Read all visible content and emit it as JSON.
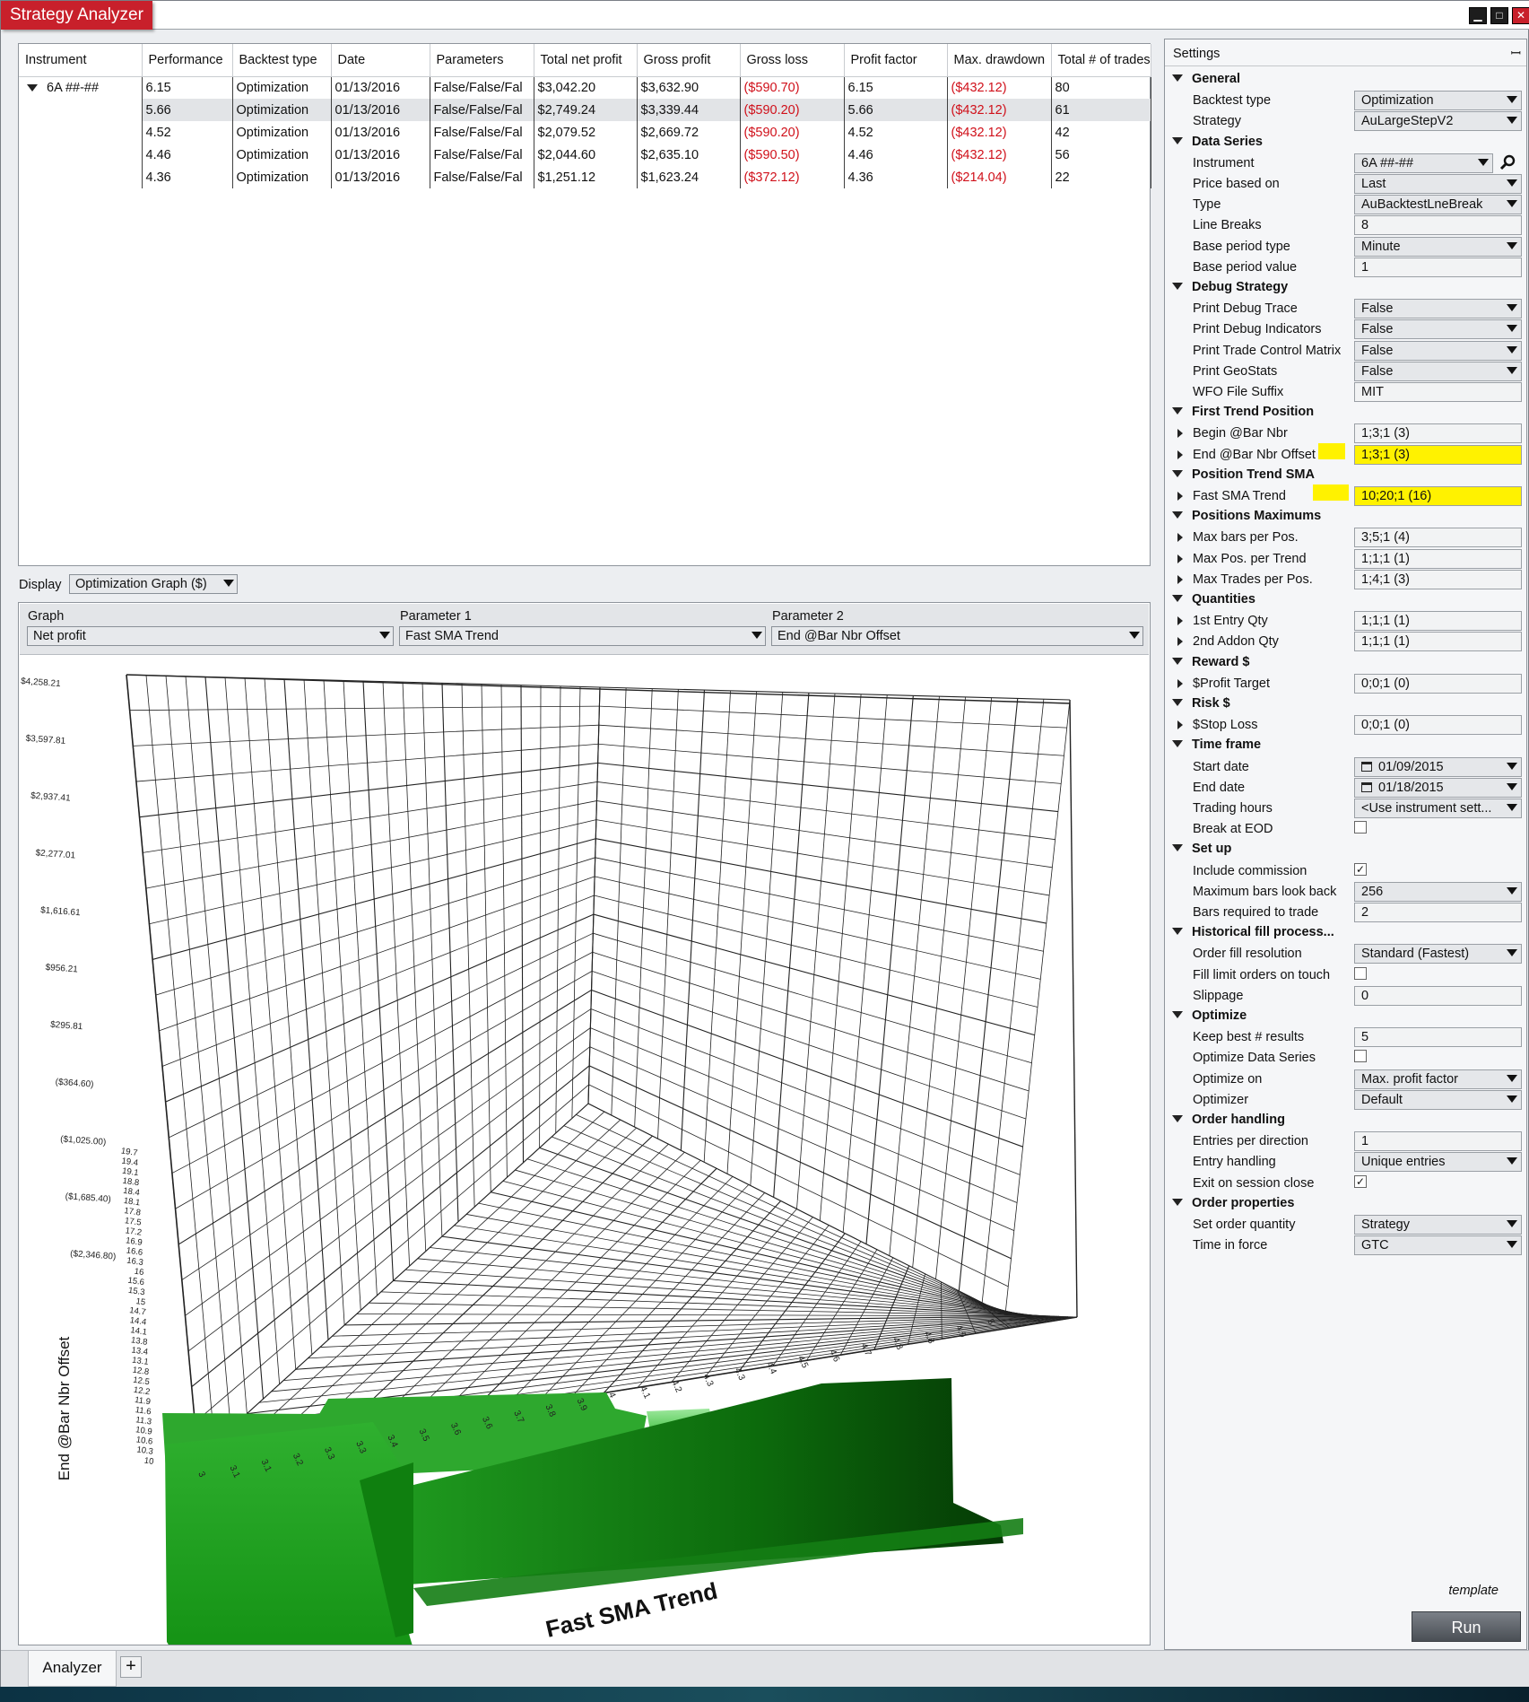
{
  "window": {
    "title": "Strategy Analyzer",
    "min_glyph": "▁",
    "max_glyph": "□",
    "close_glyph": "✕"
  },
  "grid": {
    "columns": [
      "Instrument",
      "Performance",
      "Backtest type",
      "Date",
      "Parameters",
      "Total net profit",
      "Gross profit",
      "Gross loss",
      "Profit factor",
      "Max. drawdown",
      "Total # of trades"
    ],
    "rows": [
      {
        "instrument": "6A ##-##",
        "performance": "6.15",
        "backtest": "Optimization",
        "date": "01/13/2016",
        "parameters": "False/False/Fal",
        "net": "$3,042.20",
        "gross_profit": "$3,632.90",
        "gross_loss": "($590.70)",
        "pf": "6.15",
        "dd": "($432.12)",
        "trades": "80"
      },
      {
        "instrument": "",
        "performance": "5.66",
        "backtest": "Optimization",
        "date": "01/13/2016",
        "parameters": "False/False/Fal",
        "net": "$2,749.24",
        "gross_profit": "$3,339.44",
        "gross_loss": "($590.20)",
        "pf": "5.66",
        "dd": "($432.12)",
        "trades": "61"
      },
      {
        "instrument": "",
        "performance": "4.52",
        "backtest": "Optimization",
        "date": "01/13/2016",
        "parameters": "False/False/Fal",
        "net": "$2,079.52",
        "gross_profit": "$2,669.72",
        "gross_loss": "($590.20)",
        "pf": "4.52",
        "dd": "($432.12)",
        "trades": "42"
      },
      {
        "instrument": "",
        "performance": "4.46",
        "backtest": "Optimization",
        "date": "01/13/2016",
        "parameters": "False/False/Fal",
        "net": "$2,044.60",
        "gross_profit": "$2,635.10",
        "gross_loss": "($590.50)",
        "pf": "4.46",
        "dd": "($432.12)",
        "trades": "56"
      },
      {
        "instrument": "",
        "performance": "4.36",
        "backtest": "Optimization",
        "date": "01/13/2016",
        "parameters": "False/False/Fal",
        "net": "$1,251.12",
        "gross_profit": "$1,623.24",
        "gross_loss": "($372.12)",
        "pf": "4.36",
        "dd": "($214.04)",
        "trades": "22"
      }
    ]
  },
  "display": {
    "label": "Display",
    "value": "Optimization Graph ($)"
  },
  "graph_header": {
    "graph_label": "Graph",
    "graph_value": "Net profit",
    "param1_label": "Parameter 1",
    "param1_value": "Fast SMA Trend",
    "param2_label": "Parameter 2",
    "param2_value": "End @Bar Nbr Offset"
  },
  "chart_data": {
    "type": "surface-3d",
    "title": "",
    "xlabel": "Fast SMA Trend",
    "ylabel": "End @Bar Nbr Offset",
    "zlabel": "",
    "z_ticks": [
      "$4,258.21",
      "$3,597.81",
      "$2,937.41",
      "$2,277.01",
      "$1,616.61",
      "$956.21",
      "$295.81",
      "($364.60)",
      "($1,025.00)",
      "($1,685.40)",
      "($2,346.80)"
    ],
    "x_ticks": [
      "3",
      "3.1",
      "3.1",
      "3.2",
      "3.3",
      "3.3",
      "3.4",
      "3.5",
      "3.6",
      "3.6",
      "3.7",
      "3.8",
      "3.9",
      "4",
      "4.1",
      "4.2",
      "4.3",
      "4.3",
      "4.4",
      "4.5",
      "4.6",
      "4.7",
      "4.8",
      "4.8",
      "4.9",
      "5"
    ],
    "y_ticks": [
      "10",
      "10.3",
      "10.6",
      "10.9",
      "11.3",
      "11.6",
      "11.9",
      "12.2",
      "12.5",
      "12.8",
      "13.1",
      "13.4",
      "13.8",
      "14.1",
      "14.4",
      "14.7",
      "15",
      "15.3",
      "15.6",
      "16",
      "16.3",
      "16.6",
      "16.9",
      "17.2",
      "17.5",
      "17.8",
      "18.1",
      "18.4",
      "18.8",
      "19.1",
      "19.4",
      "19.7"
    ],
    "surface_color": "#1f9a1f"
  },
  "settings": {
    "title": "Settings",
    "pin_glyph": "ꟷ",
    "groups": [
      {
        "name": "General",
        "items": [
          {
            "label": "Backtest type",
            "value": "Optimization",
            "kind": "select"
          },
          {
            "label": "Strategy",
            "value": "AuLargeStepV2",
            "kind": "select"
          }
        ]
      },
      {
        "name": "Data Series",
        "items": [
          {
            "label": "Instrument",
            "value": "6A ##-##",
            "kind": "instrument"
          },
          {
            "label": "Price based on",
            "value": "Last",
            "kind": "select"
          },
          {
            "label": "Type",
            "value": "AuBacktestLneBreak",
            "kind": "select"
          },
          {
            "label": "Line Breaks",
            "value": "8",
            "kind": "text"
          },
          {
            "label": "Base period type",
            "value": "Minute",
            "kind": "select"
          },
          {
            "label": "Base period value",
            "value": "1",
            "kind": "text"
          }
        ]
      },
      {
        "name": "Debug Strategy",
        "items": [
          {
            "label": "Print Debug Trace",
            "value": "False",
            "kind": "select"
          },
          {
            "label": "Print Debug Indicators",
            "value": "False",
            "kind": "select"
          },
          {
            "label": "Print Trade Control Matrix",
            "value": "False",
            "kind": "select"
          },
          {
            "label": "Print GeoStats",
            "value": "False",
            "kind": "select"
          },
          {
            "label": "WFO File Suffix",
            "value": "MIT",
            "kind": "text"
          }
        ]
      },
      {
        "name": "First Trend Position",
        "items": [
          {
            "label": "Begin @Bar Nbr",
            "value": "1;3;1 (3)",
            "kind": "text",
            "expand": true
          },
          {
            "label": "End @Bar Nbr Offset",
            "value": "1;3;1 (3)",
            "kind": "text",
            "expand": true,
            "highlight": true
          }
        ]
      },
      {
        "name": "Position Trend SMA",
        "items": [
          {
            "label": "Fast SMA Trend",
            "value": "10;20;1 (16)",
            "kind": "text",
            "expand": true,
            "highlight": true
          }
        ]
      },
      {
        "name": "Positions Maximums",
        "items": [
          {
            "label": "Max bars per Pos.",
            "value": "3;5;1 (4)",
            "kind": "text",
            "expand": true
          },
          {
            "label": "Max Pos. per Trend",
            "value": "1;1;1 (1)",
            "kind": "text",
            "expand": true
          },
          {
            "label": "Max Trades per Pos.",
            "value": "1;4;1 (3)",
            "kind": "text",
            "expand": true
          }
        ]
      },
      {
        "name": "Quantities",
        "items": [
          {
            "label": "1st Entry Qty",
            "value": "1;1;1 (1)",
            "kind": "text",
            "expand": true
          },
          {
            "label": "2nd Addon Qty",
            "value": "1;1;1 (1)",
            "kind": "text",
            "expand": true
          }
        ]
      },
      {
        "name": "Reward $",
        "items": [
          {
            "label": "$Profit Target",
            "value": "0;0;1 (0)",
            "kind": "text",
            "expand": true
          }
        ]
      },
      {
        "name": "Risk $",
        "items": [
          {
            "label": "$Stop Loss",
            "value": "0;0;1 (0)",
            "kind": "text",
            "expand": true
          }
        ]
      },
      {
        "name": "Time frame",
        "items": [
          {
            "label": "Start date",
            "value": "01/09/2015",
            "kind": "date"
          },
          {
            "label": "End date",
            "value": "01/18/2015",
            "kind": "date"
          },
          {
            "label": "Trading hours",
            "value": "<Use instrument sett...",
            "kind": "select"
          },
          {
            "label": "Break at EOD",
            "value": "",
            "kind": "check",
            "checked": false
          }
        ]
      },
      {
        "name": "Set up",
        "items": [
          {
            "label": "Include commission",
            "value": "",
            "kind": "check",
            "checked": true
          },
          {
            "label": "Maximum bars look back",
            "value": "256",
            "kind": "select"
          },
          {
            "label": "Bars required to trade",
            "value": "2",
            "kind": "text"
          }
        ]
      },
      {
        "name": "Historical fill process...",
        "items": [
          {
            "label": "Order fill resolution",
            "value": "Standard (Fastest)",
            "kind": "select"
          },
          {
            "label": "Fill limit orders on touch",
            "value": "",
            "kind": "check",
            "checked": false
          },
          {
            "label": "Slippage",
            "value": "0",
            "kind": "text"
          }
        ]
      },
      {
        "name": "Optimize",
        "items": [
          {
            "label": "Keep best # results",
            "value": "5",
            "kind": "text"
          },
          {
            "label": "Optimize Data Series",
            "value": "",
            "kind": "check",
            "checked": false
          },
          {
            "label": "Optimize on",
            "value": "Max. profit factor",
            "kind": "select"
          },
          {
            "label": "Optimizer",
            "value": "Default",
            "kind": "select"
          }
        ]
      },
      {
        "name": "Order handling",
        "items": [
          {
            "label": "Entries per direction",
            "value": "1",
            "kind": "text"
          },
          {
            "label": "Entry handling",
            "value": "Unique entries",
            "kind": "select"
          },
          {
            "label": "Exit on session close",
            "value": "",
            "kind": "check",
            "checked": true
          }
        ]
      },
      {
        "name": "Order properties",
        "items": [
          {
            "label": "Set order quantity",
            "value": "Strategy",
            "kind": "select"
          },
          {
            "label": "Time in force",
            "value": "GTC",
            "kind": "select"
          }
        ]
      }
    ],
    "template_label": "template",
    "run_label": "Run"
  },
  "tabs": {
    "analyzer": "Analyzer",
    "add": "+"
  },
  "colors": {
    "title_bar": "#c8202b",
    "negative": "#d0101a",
    "highlight": "#fff200",
    "surface": "#1f9a1f"
  }
}
